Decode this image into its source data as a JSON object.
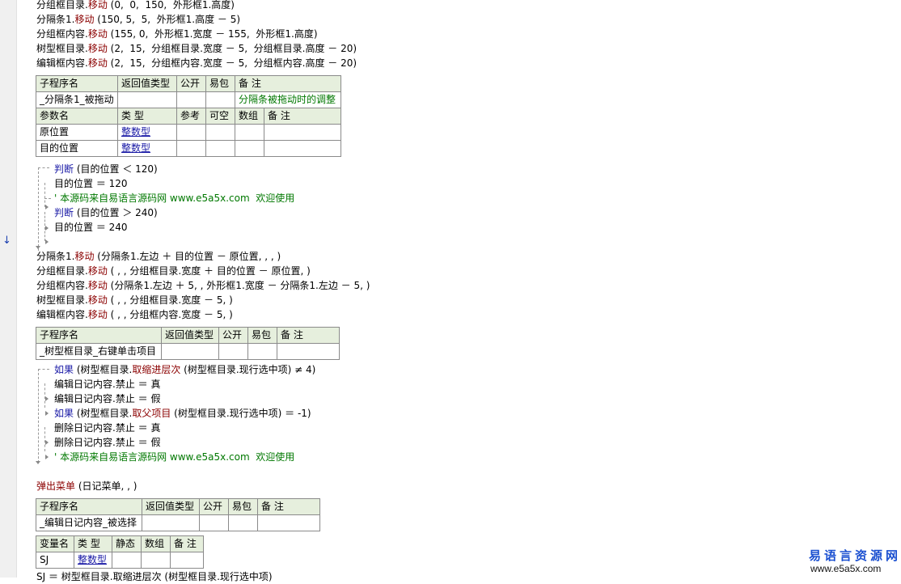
{
  "lines_top": [
    {
      "obj": "分组框目录.",
      "method": "移动",
      "args": " (0,  0,  150,  外形框1.高度)"
    },
    {
      "obj": "分隔条1.",
      "method": "移动",
      "args": " (150, 5,  5,  外形框1.高度 － 5)"
    },
    {
      "obj": "分组框内容.",
      "method": "移动",
      "args": " (155, 0,  外形框1.宽度 － 155,  外形框1.高度)"
    },
    {
      "obj": "树型框目录.",
      "method": "移动",
      "args": " (2,  15,  分组框目录.宽度 － 5,  分组框目录.高度 － 20)"
    },
    {
      "obj": "编辑框内容.",
      "method": "移动",
      "args": " (2,  15,  分组框内容.宽度 － 5,  分组框内容.高度 － 20)"
    }
  ],
  "sub1": {
    "headers": [
      "子程序名",
      "返回值类型",
      "公开",
      "易包",
      "备 注"
    ],
    "name": "_分隔条1_被拖动",
    "note": "分隔条被拖动时的调整",
    "param_headers": [
      "参数名",
      "类 型",
      "参考",
      "可空",
      "数组",
      "备 注"
    ],
    "params": [
      {
        "name": "原位置",
        "type": "整数型"
      },
      {
        "name": "目的位置",
        "type": "整数型"
      }
    ]
  },
  "block1": {
    "judge1_kw": "判断",
    "judge1_cond": " (目的位置 ＜ 120)",
    "assign1": "目的位置 ＝ 120",
    "comment": "' 本源码来自易语言源码网 www.e5a5x.com  欢迎使用",
    "judge2_kw": "判断",
    "judge2_cond": " (目的位置 ＞ 240)",
    "assign2": "目的位置 ＝ 240"
  },
  "lines_mid": [
    {
      "obj": "分隔条1.",
      "method": "移动",
      "args": " (分隔条1.左边 ＋ 目的位置 － 原位置, , , )"
    },
    {
      "obj": "分组框目录.",
      "method": "移动",
      "args": " ( , , 分组框目录.宽度 ＋ 目的位置 － 原位置, )"
    },
    {
      "obj": "分组框内容.",
      "method": "移动",
      "args": " (分隔条1.左边 ＋ 5, , 外形框1.宽度 － 分隔条1.左边 － 5, )"
    },
    {
      "obj": "树型框目录.",
      "method": "移动",
      "args": " ( , , 分组框目录.宽度 － 5, )"
    },
    {
      "obj": "编辑框内容.",
      "method": "移动",
      "args": " ( , , 分组框内容.宽度 － 5, )"
    }
  ],
  "sub2": {
    "headers": [
      "子程序名",
      "返回值类型",
      "公开",
      "易包",
      "备 注"
    ],
    "name": "_树型框目录_右键单击项目"
  },
  "block2": {
    "if1_kw": "如果",
    "if1_pre": " (树型框目录.",
    "if1_method": "取缩进层次",
    "if1_post": " (树型框目录.现行选中项) ≠ 4)",
    "l1": "编辑日记内容.禁止 ＝ 真",
    "l2": "编辑日记内容.禁止 ＝ 假",
    "if2_kw": "如果",
    "if2_pre": " (树型框目录.",
    "if2_method": "取父项目",
    "if2_post": " (树型框目录.现行选中项) ＝ -1)",
    "l3": "删除日记内容.禁止 ＝ 真",
    "l4": "删除日记内容.禁止 ＝ 假",
    "comment": "' 本源码来自易语言源码网 www.e5a5x.com  欢迎使用"
  },
  "popup": {
    "cmd": "弹出菜单",
    "args": " (日记菜单, , )"
  },
  "sub3": {
    "headers": [
      "子程序名",
      "返回值类型",
      "公开",
      "易包",
      "备 注"
    ],
    "name": "_编辑日记内容_被选择"
  },
  "var_table": {
    "headers": [
      "变量名",
      "类 型",
      "静态",
      "数组",
      "备 注"
    ],
    "rows": [
      {
        "name": "SJ",
        "type": "整数型"
      }
    ]
  },
  "last_line": "SJ ＝ 树型框目录.取缩进层次 (树型框目录.现行选中项)",
  "watermark": {
    "cn": "易语言资源网",
    "url": "www.e5a5x.com"
  },
  "colors": {
    "method": "#8b0000",
    "keyword": "#1a1aa6",
    "comment": "#007800",
    "header_bg": "#e6efdd",
    "watermark": "#1a4fd0"
  }
}
